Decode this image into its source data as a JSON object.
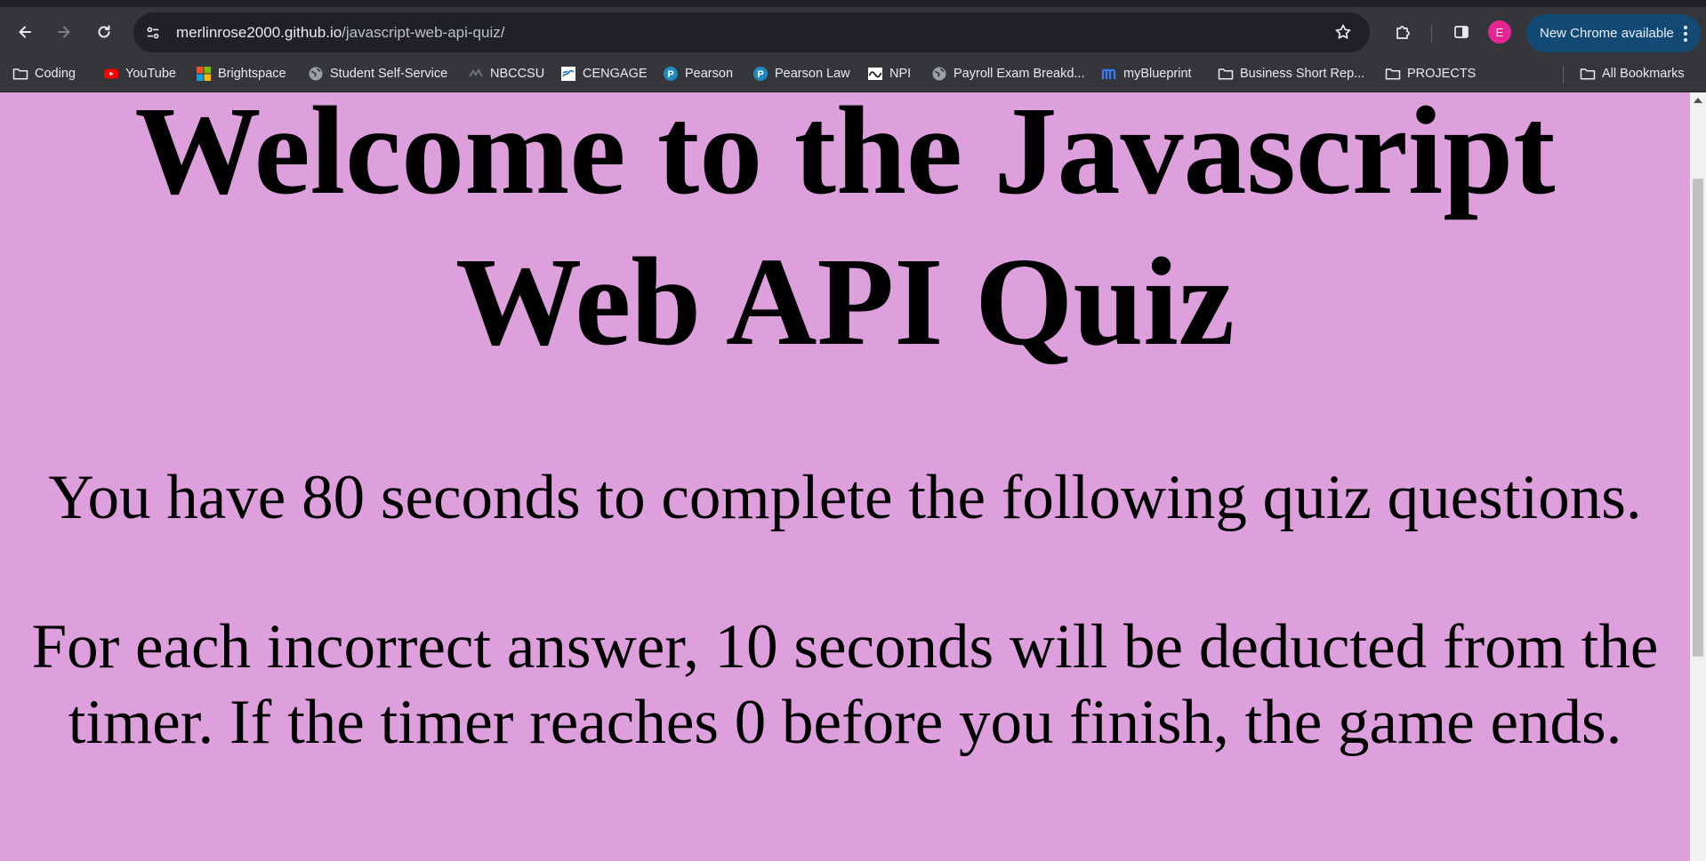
{
  "browser": {
    "url_host": "merlinrose2000.github.io",
    "url_path": "/javascript-web-api-quiz/",
    "profile_initial": "E",
    "update_label": "New Chrome available"
  },
  "bookmarks": [
    {
      "label": "Coding",
      "icon": "folder-icon"
    },
    {
      "label": "YouTube",
      "icon": "youtube-icon"
    },
    {
      "label": "Brightspace",
      "icon": "microsoft-icon"
    },
    {
      "label": "Student Self-Service",
      "icon": "globe-icon"
    },
    {
      "label": "NBCCSU",
      "icon": "nbccsu-icon"
    },
    {
      "label": "CENGAGE",
      "icon": "cengage-icon"
    },
    {
      "label": "Pearson",
      "icon": "pearson-icon"
    },
    {
      "label": "Pearson Law",
      "icon": "pearson-icon"
    },
    {
      "label": "NPI",
      "icon": "npi-icon"
    },
    {
      "label": "Payroll Exam Breakd...",
      "icon": "globe-icon"
    },
    {
      "label": "myBlueprint",
      "icon": "myblueprint-icon"
    },
    {
      "label": "Business Short Rep...",
      "icon": "folder-icon"
    },
    {
      "label": "PROJECTS",
      "icon": "folder-icon"
    }
  ],
  "all_bookmarks_label": "All Bookmarks",
  "page": {
    "title": "Welcome to the Javascript Web API Quiz",
    "intro": "You have 80 seconds to complete the following quiz questions.",
    "rules": "For each incorrect answer, 10 seconds will be deducted from the timer. If the timer reaches 0 before you finish, the game ends.",
    "background_color": "#dda0dd"
  }
}
